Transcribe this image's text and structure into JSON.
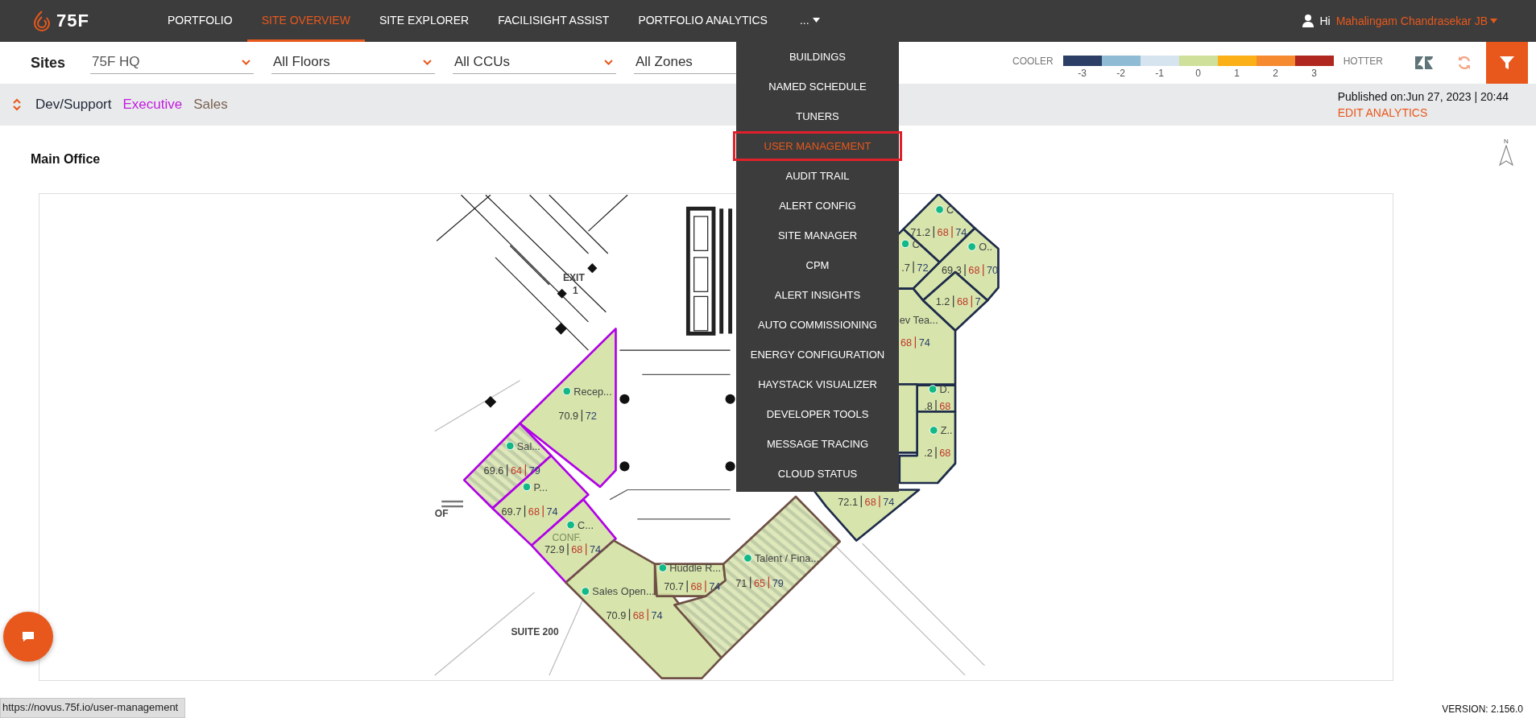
{
  "nav": {
    "logo": "75F",
    "items": [
      {
        "label": "PORTFOLIO",
        "selected": false
      },
      {
        "label": "SITE OVERVIEW",
        "selected": true
      },
      {
        "label": "SITE EXPLORER",
        "selected": false
      },
      {
        "label": "FACILISIGHT ASSIST",
        "selected": false
      },
      {
        "label": "PORTFOLIO ANALYTICS",
        "selected": false
      }
    ],
    "more": {
      "label": "...",
      "expanded": true
    },
    "greeting": "Hi",
    "user_name": "Mahalingam Chandrasekar JB"
  },
  "more_menu": {
    "items": [
      {
        "label": "BUILDINGS",
        "highlighted": false
      },
      {
        "label": "NAMED SCHEDULE",
        "highlighted": false
      },
      {
        "label": "TUNERS",
        "highlighted": false
      },
      {
        "label": "USER MANAGEMENT",
        "highlighted": true
      },
      {
        "label": "AUDIT TRAIL",
        "highlighted": false
      },
      {
        "label": "ALERT CONFIG",
        "highlighted": false
      },
      {
        "label": "SITE MANAGER",
        "highlighted": false
      },
      {
        "label": "CPM",
        "highlighted": false
      },
      {
        "label": "ALERT INSIGHTS",
        "highlighted": false
      },
      {
        "label": "AUTO COMMISSIONING",
        "highlighted": false
      },
      {
        "label": "ENERGY CONFIGURATION",
        "highlighted": false
      },
      {
        "label": "HAYSTACK VISUALIZER",
        "highlighted": false
      },
      {
        "label": "DEVELOPER TOOLS",
        "highlighted": false
      },
      {
        "label": "MESSAGE TRACING",
        "highlighted": false
      },
      {
        "label": "CLOUD STATUS",
        "highlighted": false
      }
    ]
  },
  "filters": {
    "sites_label": "Sites",
    "selects": [
      {
        "value": "75F HQ"
      },
      {
        "value": "All Floors"
      },
      {
        "value": "All CCUs"
      },
      {
        "value": "All Zones"
      }
    ]
  },
  "scale": {
    "cool_label": "COOLER",
    "hot_label": "HOTTER",
    "steps": [
      {
        "label": "-3",
        "color": "#2c3e66"
      },
      {
        "label": "-2",
        "color": "#8fbcd4"
      },
      {
        "label": "-1",
        "color": "#d6e4f0"
      },
      {
        "label": "0",
        "color": "#cfe09a"
      },
      {
        "label": "1",
        "color": "#fbb017"
      },
      {
        "label": "2",
        "color": "#f58a2e"
      },
      {
        "label": "3",
        "color": "#b0271f"
      }
    ]
  },
  "groups": [
    {
      "name": "Dev/Support",
      "color": "#222a3a"
    },
    {
      "name": "Executive",
      "color": "#c21cdf"
    },
    {
      "name": "Sales",
      "color": "#7a6353"
    }
  ],
  "published": "Published on:Jun 27, 2023 | 20:44",
  "edit_link": "EDIT ANALYTICS",
  "floor": {
    "title": "Main Office",
    "north": "N",
    "plan_labels": [
      "EXIT",
      "1",
      "SUITE 200",
      "OF",
      "CONF."
    ],
    "zones": [
      {
        "name": "Recep...",
        "color": "#b000e8",
        "hatched": false,
        "readings": [
          {
            "text": "70.9",
            "kind": "current"
          },
          {
            "text": "72",
            "kind": "cool"
          }
        ]
      },
      {
        "name": "Sal...",
        "color": "#b000e8",
        "hatched": true,
        "readings": [
          {
            "text": "69.6",
            "kind": "current"
          },
          {
            "text": "64",
            "kind": "heat"
          },
          {
            "text": "79",
            "kind": "cool"
          }
        ]
      },
      {
        "name": "P...",
        "color": "#b000e8",
        "hatched": false,
        "readings": [
          {
            "text": "69.7",
            "kind": "current"
          },
          {
            "text": "68",
            "kind": "heat"
          },
          {
            "text": "74",
            "kind": "cool"
          }
        ]
      },
      {
        "name": "C...",
        "color": "#b000e8",
        "hatched": false,
        "readings": [
          {
            "text": "72.9",
            "kind": "current"
          },
          {
            "text": "68",
            "kind": "heat"
          },
          {
            "text": "74",
            "kind": "cool"
          }
        ]
      },
      {
        "name": "Sales Open...",
        "color": "#6e5045",
        "hatched": false,
        "readings": [
          {
            "text": "70.9",
            "kind": "current"
          },
          {
            "text": "68",
            "kind": "heat"
          },
          {
            "text": "74",
            "kind": "cool"
          }
        ]
      },
      {
        "name": "Huddle R...",
        "color": "#6e5045",
        "hatched": false,
        "readings": [
          {
            "text": "70.7",
            "kind": "current"
          },
          {
            "text": "68",
            "kind": "heat"
          },
          {
            "text": "74",
            "kind": "cool"
          }
        ]
      },
      {
        "name": "Talent / Fina...",
        "color": "#6e5045",
        "hatched": true,
        "readings": [
          {
            "text": "71",
            "kind": "current"
          },
          {
            "text": "65",
            "kind": "heat"
          },
          {
            "text": "79",
            "kind": "cool"
          }
        ]
      },
      {
        "name": "C",
        "color": "#1e2b4a",
        "hatched": false,
        "readings": [
          {
            "text": "71.2",
            "kind": "current"
          },
          {
            "text": "68",
            "kind": "heat"
          },
          {
            "text": "74",
            "kind": "cool"
          }
        ]
      },
      {
        "name": "C",
        "color": "#1e2b4a",
        "hatched": false,
        "readings": [
          {
            "text": ".7",
            "kind": "current"
          },
          {
            "text": "72",
            "kind": "cool"
          }
        ]
      },
      {
        "name": "O..",
        "color": "#1e2b4a",
        "hatched": false,
        "readings": [
          {
            "text": "69.3",
            "kind": "current"
          },
          {
            "text": "68",
            "kind": "heat"
          },
          {
            "text": "70",
            "kind": "cool"
          }
        ]
      },
      {
        "color": "#1e2b4a",
        "hatched": false,
        "readings": [
          {
            "text": "1.2",
            "kind": "current"
          },
          {
            "text": "68",
            "kind": "heat"
          },
          {
            "text": "7",
            "kind": "cool"
          }
        ]
      },
      {
        "name": "ev Tea...",
        "color": "#1e2b4a",
        "hatched": false,
        "readings": [
          {
            "text": "68",
            "kind": "heat"
          },
          {
            "text": "74",
            "kind": "cool"
          }
        ]
      },
      {
        "name": "D.",
        "color": "#1e2b4a",
        "hatched": false,
        "readings": [
          {
            "text": ".8",
            "kind": "current"
          },
          {
            "text": "68",
            "kind": "heat"
          }
        ]
      },
      {
        "name": "Z..",
        "color": "#1e2b4a",
        "hatched": false,
        "readings": [
          {
            "text": ".2",
            "kind": "current"
          },
          {
            "text": "68",
            "kind": "heat"
          }
        ]
      },
      {
        "color": "#1e2b4a",
        "hatched": false,
        "readings": [
          {
            "text": "72.1",
            "kind": "current"
          },
          {
            "text": "68",
            "kind": "heat"
          },
          {
            "text": "74",
            "kind": "cool"
          }
        ]
      },
      {
        "color": "#1e2b4a",
        "hatched": false
      }
    ]
  },
  "status_url": "https://novus.75f.io/user-management",
  "version": "VERSION: 2.156.0"
}
